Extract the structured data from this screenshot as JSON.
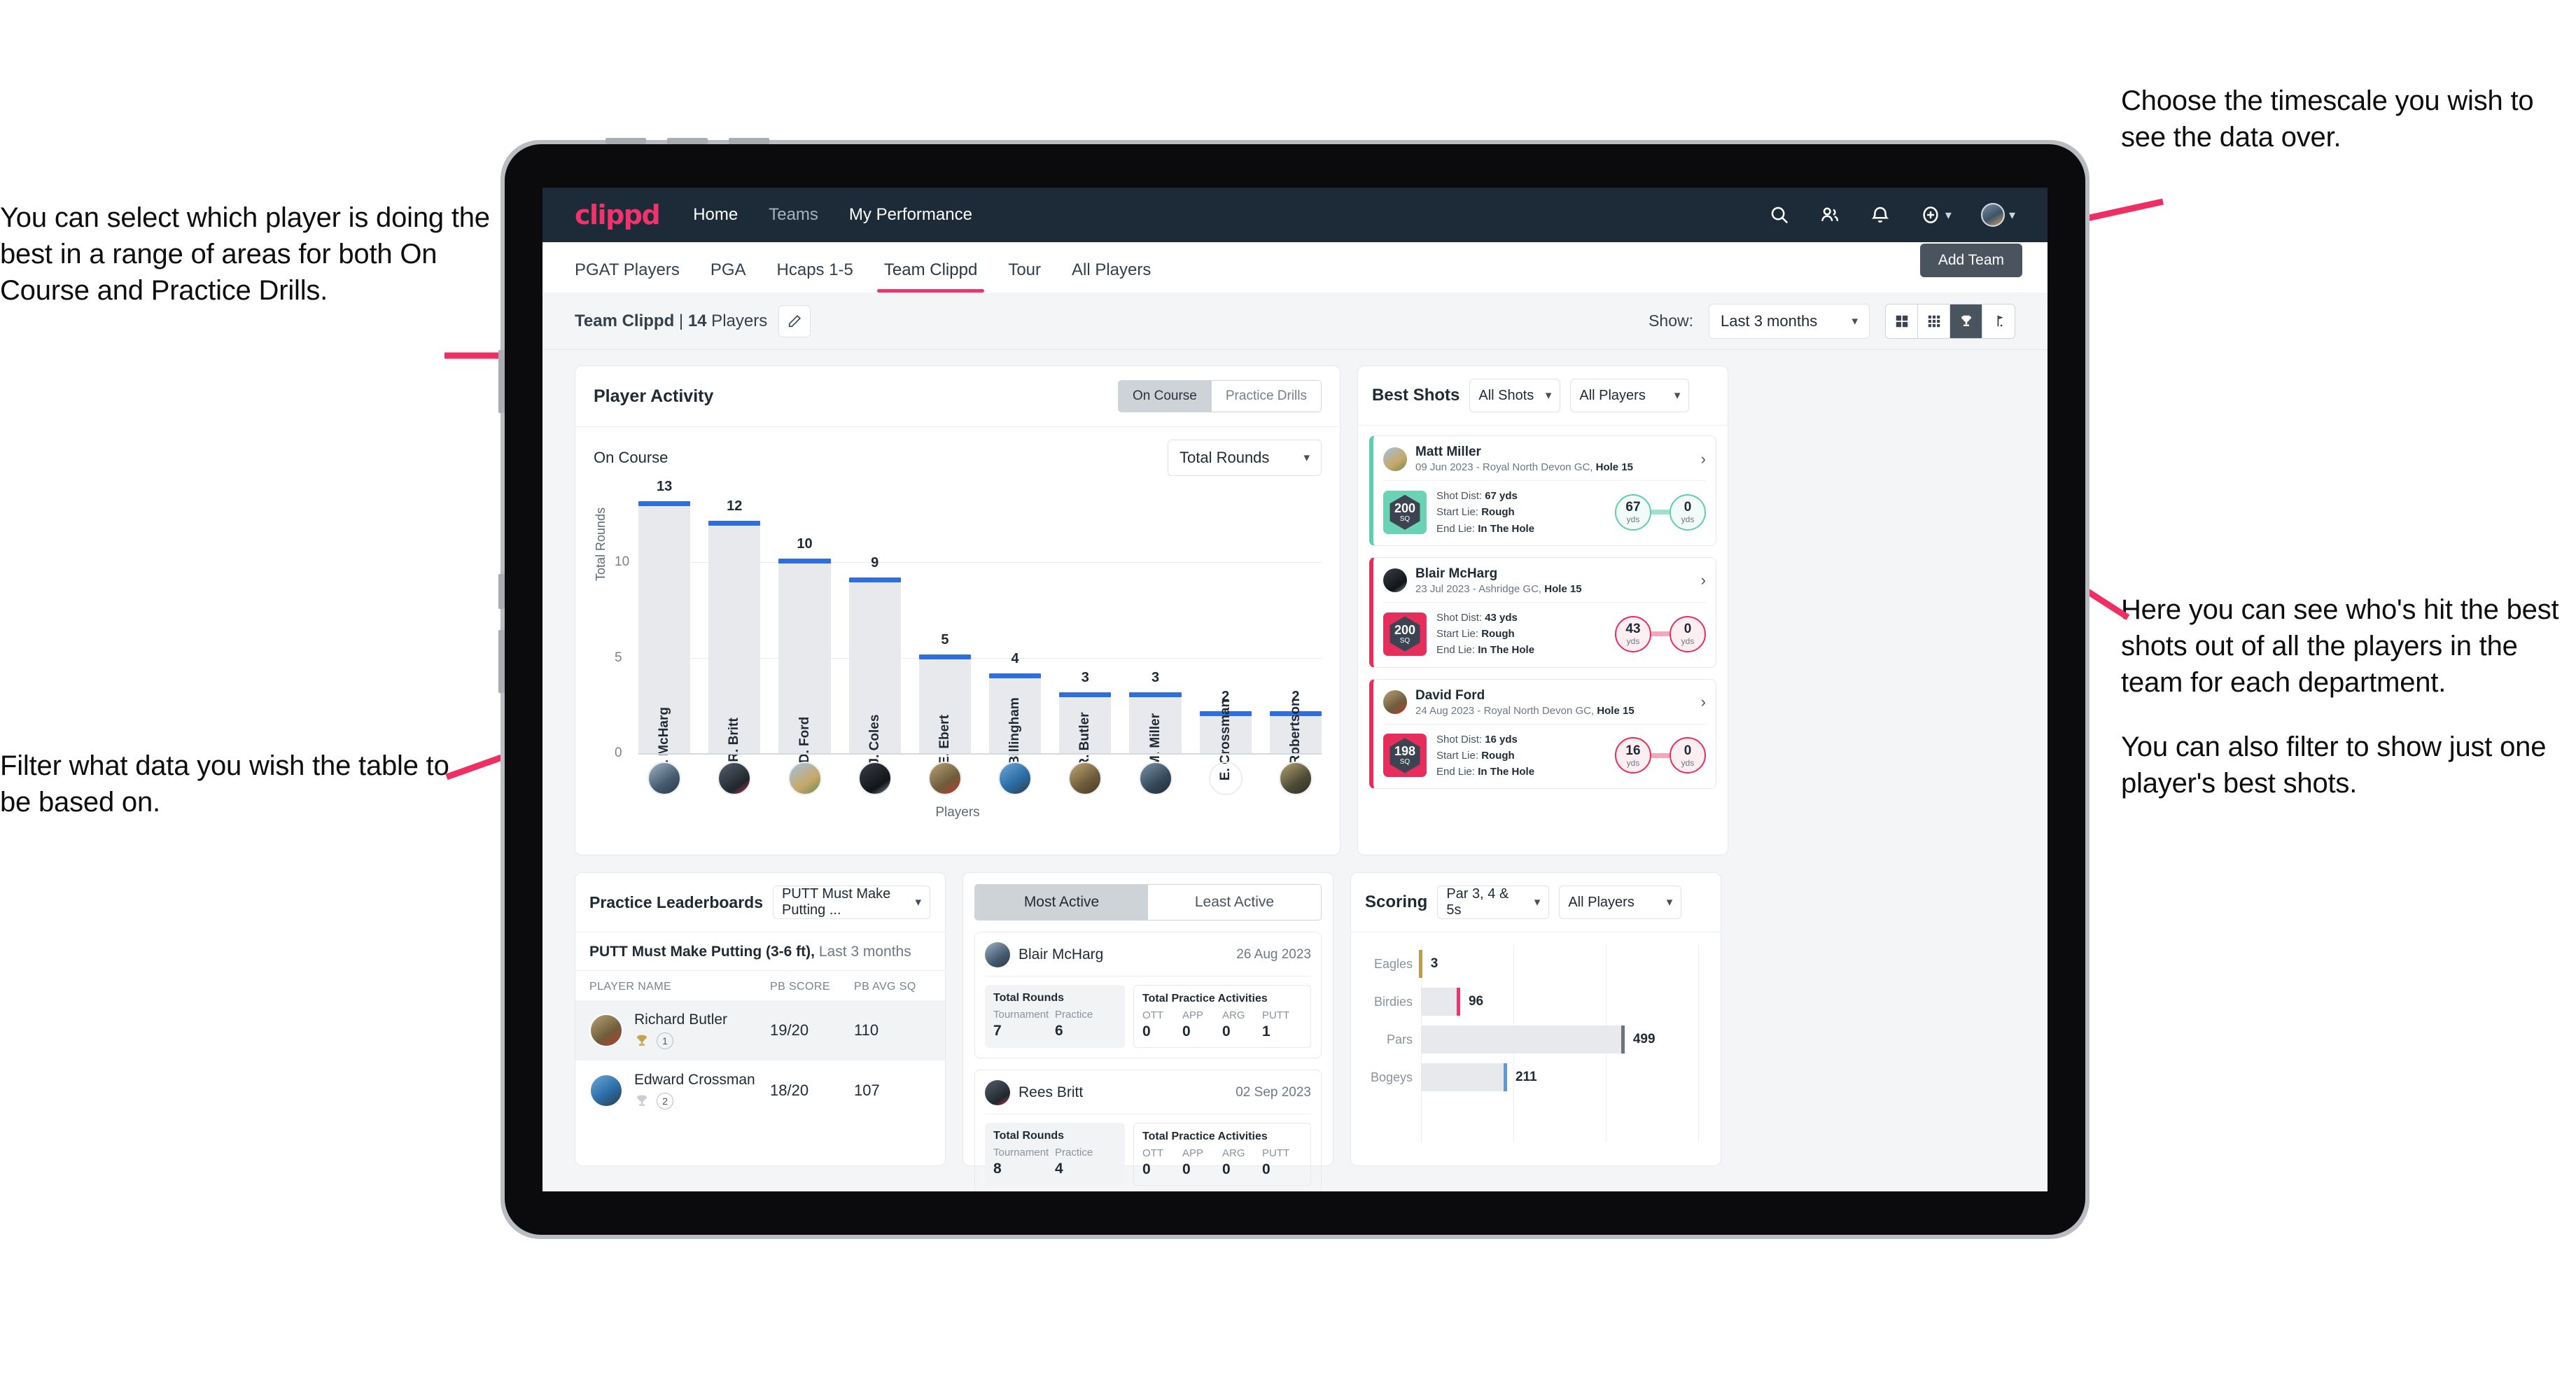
{
  "annotations": {
    "left_top": "You can select which player is doing the best in a range of areas for both On Course and Practice Drills.",
    "left_bottom": "Filter what data you wish the table to be based on.",
    "right_top": "Choose the timescale you wish to see the data over.",
    "right_mid": "Here you can see who's hit the best shots out of all the players in the team for each department.",
    "right_bottom": "You can also filter to show just one player's best shots."
  },
  "topnav": {
    "logo": "clippd",
    "links": [
      {
        "label": "Home",
        "active": true
      },
      {
        "label": "Teams",
        "active": false
      },
      {
        "label": "My Performance",
        "active": true
      }
    ],
    "icons": [
      "search-icon",
      "people-icon",
      "bell-icon",
      "plus-circle-icon"
    ],
    "avatar": "user-avatar"
  },
  "tabs": [
    {
      "label": "PGAT Players",
      "active": false
    },
    {
      "label": "PGA",
      "active": false
    },
    {
      "label": "Hcaps 1-5",
      "active": false
    },
    {
      "label": "Team Clippd",
      "active": true
    },
    {
      "label": "Tour",
      "active": false
    },
    {
      "label": "All Players",
      "active": false
    }
  ],
  "tooltip": {
    "add_team": "Add Team"
  },
  "subbar": {
    "team_name": "Team Clippd",
    "separator": " | ",
    "player_count": "14",
    "players_word": " Players",
    "show_label": "Show:",
    "timescale": "Last 3 months",
    "view_icons": [
      "grid-large-icon",
      "grid-small-icon",
      "trophy-icon",
      "flag-icon"
    ],
    "active_view": "trophy-icon"
  },
  "player_activity": {
    "title": "Player Activity",
    "segments": [
      {
        "label": "On Course",
        "active": true
      },
      {
        "label": "Practice Drills",
        "active": false
      }
    ],
    "sub_label": "On Course",
    "metric": "Total Rounds"
  },
  "best_shots": {
    "title": "Best Shots",
    "filter_shots": "All Shots",
    "filter_players": "All Players",
    "shots": [
      {
        "name": "Matt Miller",
        "meta_date": "09 Jun 2023 - Royal North Devon GC, ",
        "meta_hole": "Hole 15",
        "sq": "200",
        "sq_unit": "SQ",
        "accent": "teal",
        "shot_dist_label": "Shot Dist: ",
        "shot_dist": "67 yds",
        "start_lie_label": "Start Lie: ",
        "start_lie": "Rough",
        "end_lie_label": "End Lie: ",
        "end_lie": "In The Hole",
        "from_val": "67",
        "from_unit": "yds",
        "to_val": "0",
        "to_unit": "yds"
      },
      {
        "name": "Blair McHarg",
        "meta_date": "23 Jul 2023 - Ashridge GC, ",
        "meta_hole": "Hole 15",
        "sq": "200",
        "sq_unit": "SQ",
        "accent": "pink",
        "shot_dist_label": "Shot Dist: ",
        "shot_dist": "43 yds",
        "start_lie_label": "Start Lie: ",
        "start_lie": "Rough",
        "end_lie_label": "End Lie: ",
        "end_lie": "In The Hole",
        "from_val": "43",
        "from_unit": "yds",
        "to_val": "0",
        "to_unit": "yds"
      },
      {
        "name": "David Ford",
        "meta_date": "24 Aug 2023 - Royal North Devon GC, ",
        "meta_hole": "Hole 15",
        "sq": "198",
        "sq_unit": "SQ",
        "accent": "pink",
        "shot_dist_label": "Shot Dist: ",
        "shot_dist": "16 yds",
        "start_lie_label": "Start Lie: ",
        "start_lie": "Rough",
        "end_lie_label": "End Lie: ",
        "end_lie": "In The Hole",
        "from_val": "16",
        "from_unit": "yds",
        "to_val": "0",
        "to_unit": "yds"
      }
    ]
  },
  "practice_leaderboards": {
    "title": "Practice Leaderboards",
    "drill_select": "PUTT Must Make Putting ...",
    "subtitle_bold": "PUTT Must Make Putting (3-6 ft),",
    "subtitle_rest": " Last 3 months",
    "columns": [
      "PLAYER NAME",
      "PB SCORE",
      "PB AVG SQ"
    ],
    "rows": [
      {
        "name": "Richard Butler",
        "rank": "1",
        "trophy": "gold",
        "pb_score": "19/20",
        "pb_avg_sq": "110"
      },
      {
        "name": "Edward Crossman",
        "rank": "2",
        "trophy": "silver",
        "pb_score": "18/20",
        "pb_avg_sq": "107"
      }
    ]
  },
  "most_active": {
    "tabs": [
      {
        "label": "Most Active",
        "active": true
      },
      {
        "label": "Least Active",
        "active": false
      }
    ],
    "cards": [
      {
        "name": "Blair McHarg",
        "date": "26 Aug 2023",
        "rounds_title": "Total Rounds",
        "rounds": [
          {
            "key": "Tournament",
            "value": "7"
          },
          {
            "key": "Practice",
            "value": "6"
          }
        ],
        "practice_title": "Total Practice Activities",
        "practice": [
          {
            "key": "OTT",
            "value": "0"
          },
          {
            "key": "APP",
            "value": "0"
          },
          {
            "key": "ARG",
            "value": "0"
          },
          {
            "key": "PUTT",
            "value": "1"
          }
        ]
      },
      {
        "name": "Rees Britt",
        "date": "02 Sep 2023",
        "rounds_title": "Total Rounds",
        "rounds": [
          {
            "key": "Tournament",
            "value": "8"
          },
          {
            "key": "Practice",
            "value": "4"
          }
        ],
        "practice_title": "Total Practice Activities",
        "practice": [
          {
            "key": "OTT",
            "value": "0"
          },
          {
            "key": "APP",
            "value": "0"
          },
          {
            "key": "ARG",
            "value": "0"
          },
          {
            "key": "PUTT",
            "value": "0"
          }
        ]
      }
    ]
  },
  "scoring": {
    "title": "Scoring",
    "filter_par": "Par 3, 4 & 5s",
    "filter_players": "All Players"
  },
  "colors": {
    "brand_pink": "#f0336a",
    "nav_dark": "#1d2b39",
    "bar_blue": "#2f6fdd",
    "bar_fill": "#e7e9ed",
    "teal": "#5ecfae",
    "eagles_gold": "#c09a4a",
    "bogeys_blue": "#5e9bd6"
  },
  "chart_data": [
    {
      "type": "bar",
      "title": "Player Activity - On Course",
      "xlabel": "Players",
      "ylabel": "Total Rounds",
      "ylim": [
        0,
        14
      ],
      "yticks": [
        0,
        5,
        10
      ],
      "grid": true,
      "categories": [
        "B. McHarg",
        "R. Britt",
        "D. Ford",
        "J. Coles",
        "E. Ebert",
        "D. Billingham",
        "R. Butler",
        "M. Miller",
        "E. Crossman",
        "C. Robertson"
      ],
      "values": [
        13,
        12,
        10,
        9,
        5,
        4,
        3,
        3,
        2,
        2
      ]
    },
    {
      "type": "bar",
      "orientation": "horizontal",
      "title": "Scoring",
      "xlabel": "",
      "ylabel": "",
      "xlim": [
        0,
        700
      ],
      "grid": true,
      "categories": [
        "Eagles",
        "Birdies",
        "Pars",
        "Bogeys"
      ],
      "values": [
        3,
        96,
        499,
        211
      ],
      "cap_colors": [
        "#c09a4a",
        "#f0336a",
        "#6b7582",
        "#5e9bd6"
      ]
    }
  ]
}
